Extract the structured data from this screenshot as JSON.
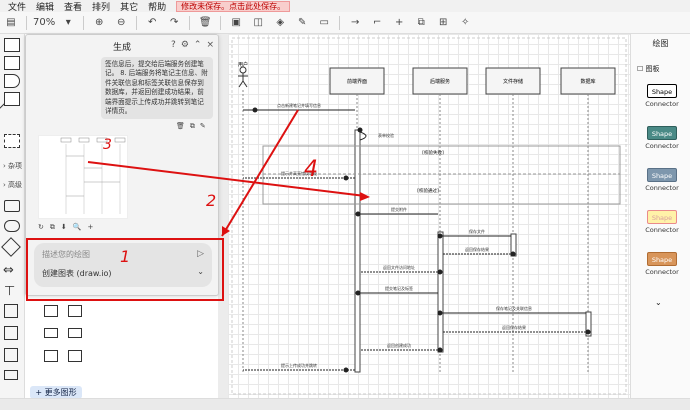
{
  "menu": {
    "items": [
      "文件",
      "编辑",
      "查看",
      "排列",
      "其它",
      "帮助"
    ],
    "unsaved": "修改未保存。点击此处保存。"
  },
  "toolbar": {
    "zoom": "70%"
  },
  "generator": {
    "title": "生成",
    "message": "签信息后，提交给后端服务创建笔记。 8. 后端服务将笔记主信息、附件关联信息和标签关联信息保存到数据库，并返回创建成功结果，前端界面提示上传成功并跳转到笔记详情页。",
    "input_placeholder": "描述您的绘图",
    "model": "创建图表 (draw.io)"
  },
  "left_panel": {
    "misc": "杂项",
    "advanced": "高级",
    "more_shapes": "+ 更多图形"
  },
  "right_panel": {
    "title": "绘图",
    "page_label": "图板",
    "styles": [
      {
        "label": "Shape",
        "caption": "Connector",
        "fill": "#ffffff",
        "stroke": "#000000",
        "text": "#000000"
      },
      {
        "label": "Shape",
        "caption": "Connector",
        "fill": "#4a8a86",
        "stroke": "#2f5f5c",
        "text": "#ffffff"
      },
      {
        "label": "Shape",
        "caption": "Connector",
        "fill": "#7e97ad",
        "stroke": "#5a7187",
        "text": "#ffffff"
      },
      {
        "label": "Shape",
        "caption": "Connector",
        "fill": "#fff2a8",
        "stroke": "#ea8b8b",
        "text": "#d9a0a0"
      },
      {
        "label": "Shape",
        "caption": "Connector",
        "fill": "#d8955a",
        "stroke": "#b06c32",
        "text": "#ffffff"
      }
    ]
  },
  "annotations": {
    "n1": "1",
    "n2": "2",
    "n3": "3",
    "n4": "4"
  },
  "diagram": {
    "actor": "用户",
    "lanes": [
      "前端界面",
      "后端服务",
      "文件存储",
      "数据库"
    ],
    "messages": [
      "点击新建笔记并填写信息",
      "表单校验",
      "[校验失败]",
      "提示并高亮错误字段",
      "[校验通过]",
      "提交附件",
      "保存文件",
      "返回保存结果",
      "返回文件访问地址",
      "提交笔记及标签",
      "保存笔记及关联信息",
      "返回保存结果",
      "返回创建成功",
      "提示上传成功并跳转"
    ],
    "steps": [
      "1",
      "2",
      "3",
      "4",
      "5",
      "6",
      "7",
      "8",
      "9",
      "10",
      "11",
      "12"
    ]
  }
}
